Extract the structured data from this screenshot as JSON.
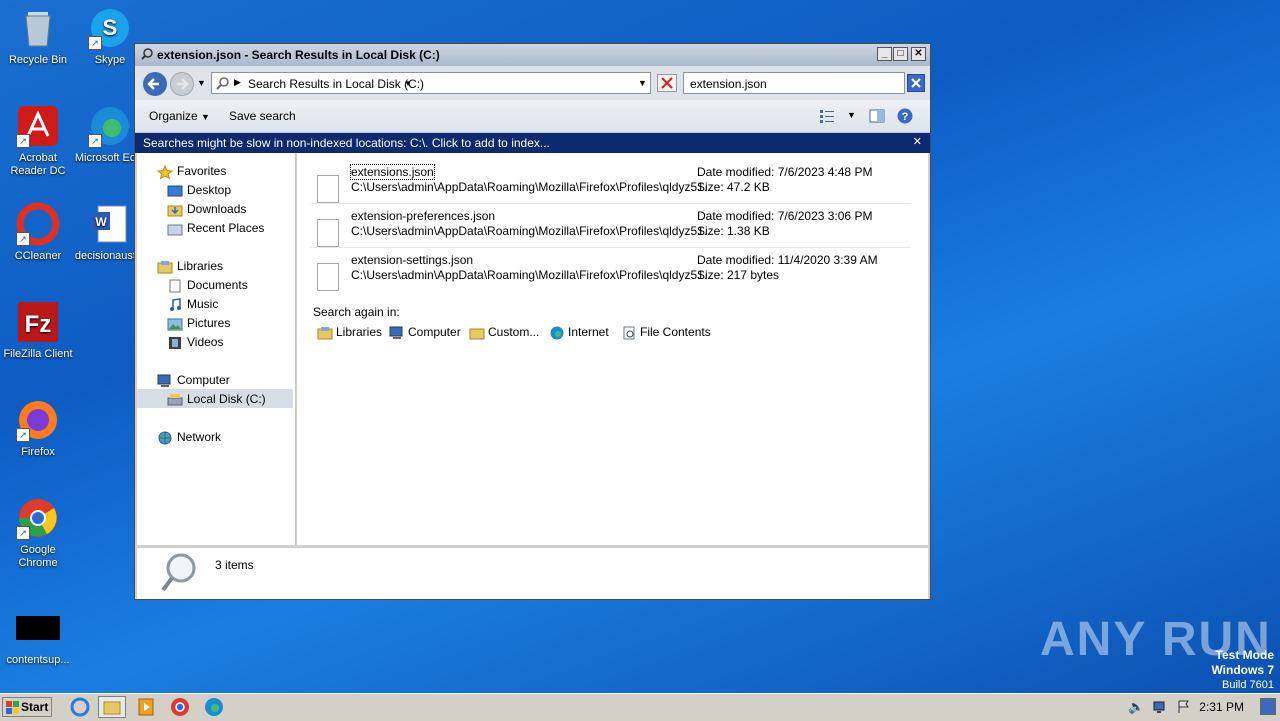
{
  "desktop": {
    "icons": [
      {
        "label": "Recycle Bin"
      },
      {
        "label": "Skype"
      },
      {
        "label": "Acrobat Reader DC"
      },
      {
        "label": "Microsoft Ed..."
      },
      {
        "label": "CCleaner"
      },
      {
        "label": "decisionaust..."
      },
      {
        "label": "FileZilla Client"
      },
      {
        "label": "Firefox"
      },
      {
        "label": "Google Chrome"
      },
      {
        "label": "contentsup..."
      }
    ]
  },
  "window": {
    "title": "extension.json - Search Results in Local Disk (C:)",
    "address": "Search Results in Local Disk (C:)",
    "search_value": "extension.json",
    "toolbar": {
      "organize": "Organize",
      "save_search": "Save search"
    },
    "infobar": "Searches might be slow in non-indexed locations: C:\\. Click to add to index...",
    "nav": {
      "favorites": "Favorites",
      "desktop": "Desktop",
      "downloads": "Downloads",
      "recent_places": "Recent Places",
      "libraries": "Libraries",
      "documents": "Documents",
      "music": "Music",
      "pictures": "Pictures",
      "videos": "Videos",
      "computer": "Computer",
      "local_disk": "Local Disk (C:)",
      "network": "Network"
    },
    "results": [
      {
        "name": "extensions.json",
        "path": "C:\\Users\\admin\\AppData\\Roaming\\Mozilla\\Firefox\\Profiles\\qldyz51...",
        "date": "Date modified: 7/6/2023 4:48 PM",
        "size": "Size: 47.2 KB"
      },
      {
        "name": "extension-preferences.json",
        "path": "C:\\Users\\admin\\AppData\\Roaming\\Mozilla\\Firefox\\Profiles\\qldyz51...",
        "date": "Date modified: 7/6/2023 3:06 PM",
        "size": "Size: 1.38 KB"
      },
      {
        "name": "extension-settings.json",
        "path": "C:\\Users\\admin\\AppData\\Roaming\\Mozilla\\Firefox\\Profiles\\qldyz51...",
        "date": "Date modified: 11/4/2020 3:39 AM",
        "size": "Size: 217 bytes"
      }
    ],
    "search_again": {
      "label": "Search again in:",
      "items": [
        "Libraries",
        "Computer",
        "Custom...",
        "Internet",
        "File Contents"
      ]
    },
    "details": "3 items"
  },
  "taskbar": {
    "start": "Start",
    "clock": "2:31 PM"
  },
  "watermark": {
    "line1": "Test Mode",
    "line2": "Windows 7",
    "line3": "Build 7601",
    "brand": "ANY RUN"
  }
}
